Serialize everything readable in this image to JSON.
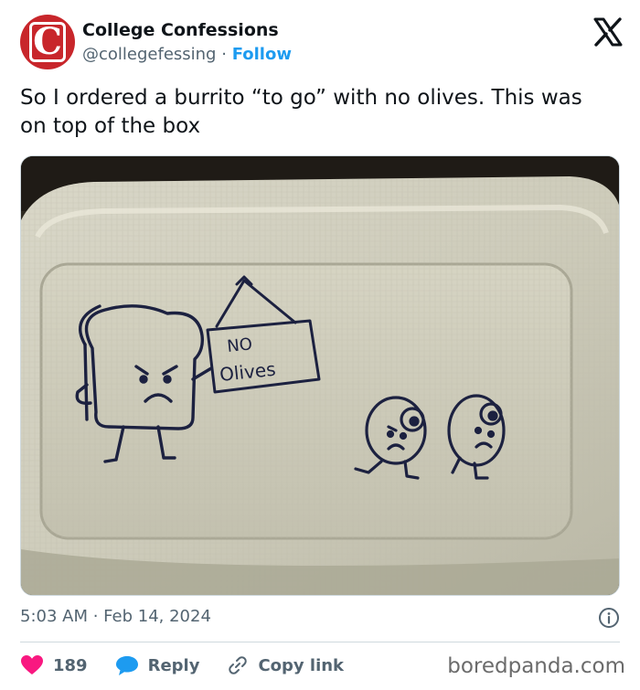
{
  "account": {
    "display_name": "College Confessions",
    "handle": "@collegefessing",
    "separator": "·",
    "follow_label": "Follow",
    "avatar_letter": "C",
    "avatar_color": "#c8262b"
  },
  "tweet": {
    "text": "So I ordered a burrito “to go” with no olives. This was on top of the box",
    "timestamp": "5:03 AM · Feb 14, 2024"
  },
  "image": {
    "sign_line1": "NO",
    "sign_line2": "Olives"
  },
  "actions": {
    "like_count": "189",
    "reply_label": "Reply",
    "copy_link_label": "Copy link"
  },
  "watermark": "boredpanda.com",
  "colors": {
    "accent": "#1d9bf0",
    "like": "#f91880",
    "text": "#0f1419",
    "muted": "#536471"
  },
  "icons": [
    "x-logo-icon",
    "info-icon",
    "heart-icon",
    "reply-bubble-icon",
    "link-icon"
  ]
}
